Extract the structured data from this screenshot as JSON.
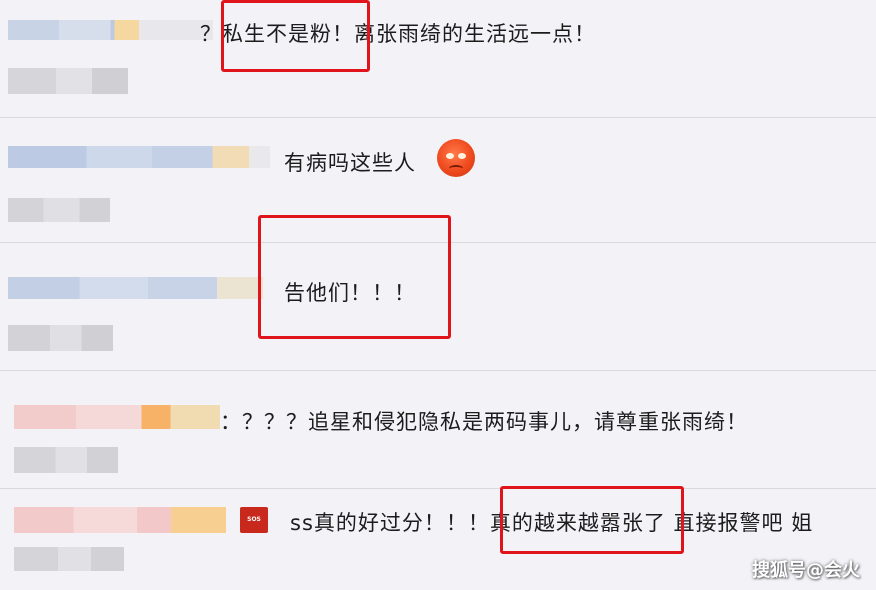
{
  "comments": [
    {
      "text": "？私生不是粉！离张雨绮的生活远一点！"
    },
    {
      "text": "有病吗这些人"
    },
    {
      "text": "告他们！！！"
    },
    {
      "text": "：？？？追星和侵犯隐私是两码事儿，请尊重张雨绮！"
    },
    {
      "text": "ss真的好过分！！！真的越来越嚣张了 直接报警吧 姐"
    }
  ],
  "icons": {
    "row2_emoji": "angry-face-icon",
    "row5_emoji": "sos-icon"
  },
  "watermark": "搜狐号@会火",
  "colors": {
    "background": "#f3f2f7",
    "highlight": "#e0151b"
  }
}
